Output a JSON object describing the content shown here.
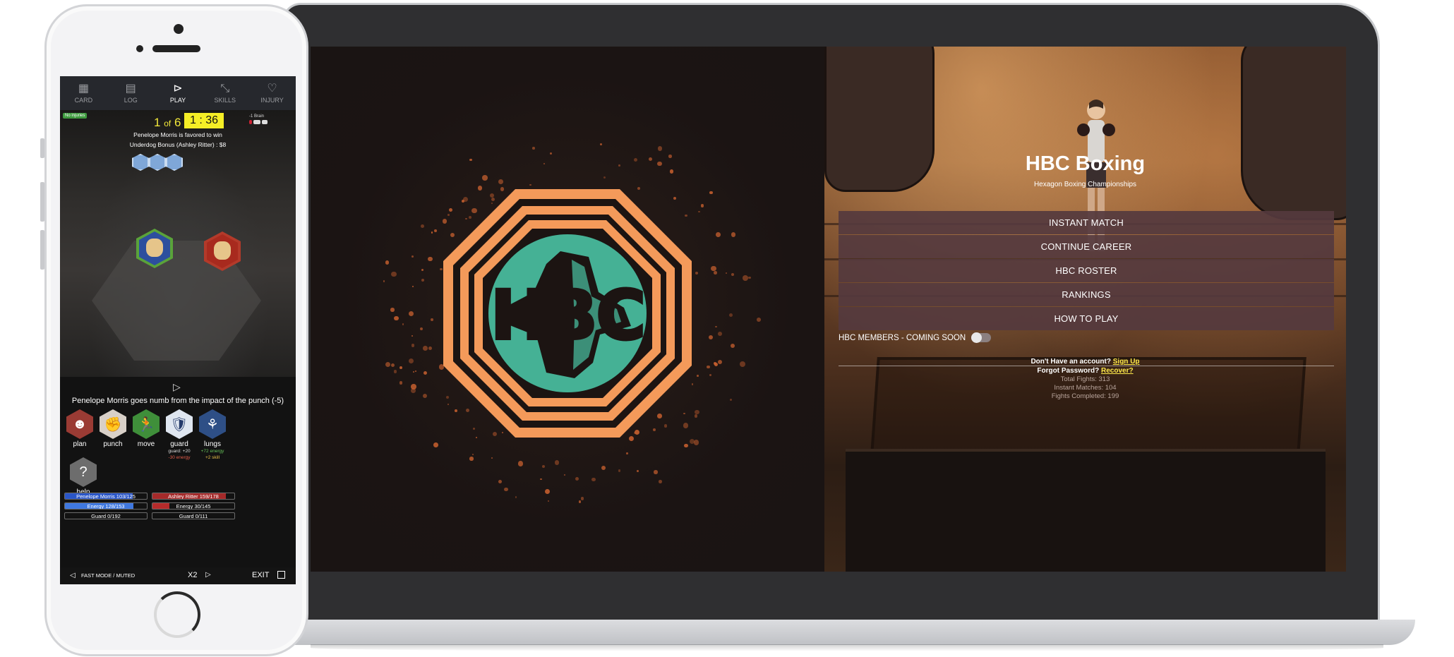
{
  "laptop": {
    "logo": {
      "letters": "HBC"
    },
    "menu": {
      "title": "HBC Boxing",
      "subtitle": "Hexagon Boxing Championships",
      "buttons": [
        "INSTANT MATCH",
        "CONTINUE CAREER",
        "HBC ROSTER",
        "RANKINGS",
        "HOW TO PLAY"
      ],
      "members_label": "HBC MEMBERS - COMING SOON",
      "members_toggle_on": false,
      "no_account_text": "Don't Have an account?",
      "sign_up_link": "Sign Up",
      "forgot_text": "Forgot Password?",
      "recover_link": "Recover?",
      "stats": [
        "Total Fights: 313",
        "Instant Matches: 104",
        "Fights Completed: 199"
      ]
    }
  },
  "phone": {
    "tabs": [
      {
        "label": "CARD",
        "icon": "card-icon"
      },
      {
        "label": "LOG",
        "icon": "log-icon"
      },
      {
        "label": "PLAY",
        "icon": "play-icon",
        "active": true
      },
      {
        "label": "SKILLS",
        "icon": "skills-icon"
      },
      {
        "label": "INJURY",
        "icon": "injury-icon"
      }
    ],
    "no_injuries": "No injuries",
    "round_current": "1",
    "round_of": "of",
    "round_total": "6",
    "timer": "1 : 36",
    "corner_text": "-1 Brain",
    "favored_text": "Penelope Morris is favored to win",
    "underdog_text": "Underdog Bonus (Ashley Ritter) : $8",
    "log_message": "Penelope Morris goes numb from the impact of the punch (-5)",
    "actions": [
      {
        "label": "plan",
        "sub": []
      },
      {
        "label": "punch",
        "sub": []
      },
      {
        "label": "move",
        "sub": []
      },
      {
        "label": "guard",
        "sub": [
          "guard: +20",
          "-30 energy"
        ]
      },
      {
        "label": "lungs",
        "sub": [
          "+72 energy",
          "+2 skill"
        ]
      }
    ],
    "help_label": "help",
    "bars": {
      "left": [
        {
          "text": "Penelope Morris 103/125",
          "fraction": 0.824,
          "color": "#2a56c8"
        },
        {
          "text": "Energy 128/153",
          "fraction": 0.837,
          "color": "#3f78e0"
        },
        {
          "text": "Guard 0/192",
          "fraction": 0.0,
          "color": "#2f7a3a"
        }
      ],
      "right": [
        {
          "text": "Ashley Ritter 159/178",
          "fraction": 0.893,
          "color": "#a52a2a"
        },
        {
          "text": "Energy 30/145",
          "fraction": 0.207,
          "color": "#b52b2b"
        },
        {
          "text": "Guard 0/111",
          "fraction": 0.0,
          "color": "#2f7a3a"
        }
      ]
    },
    "footer": {
      "mode": "FAST MODE / MUTED",
      "speed": "X2",
      "exit": "EXIT"
    }
  }
}
